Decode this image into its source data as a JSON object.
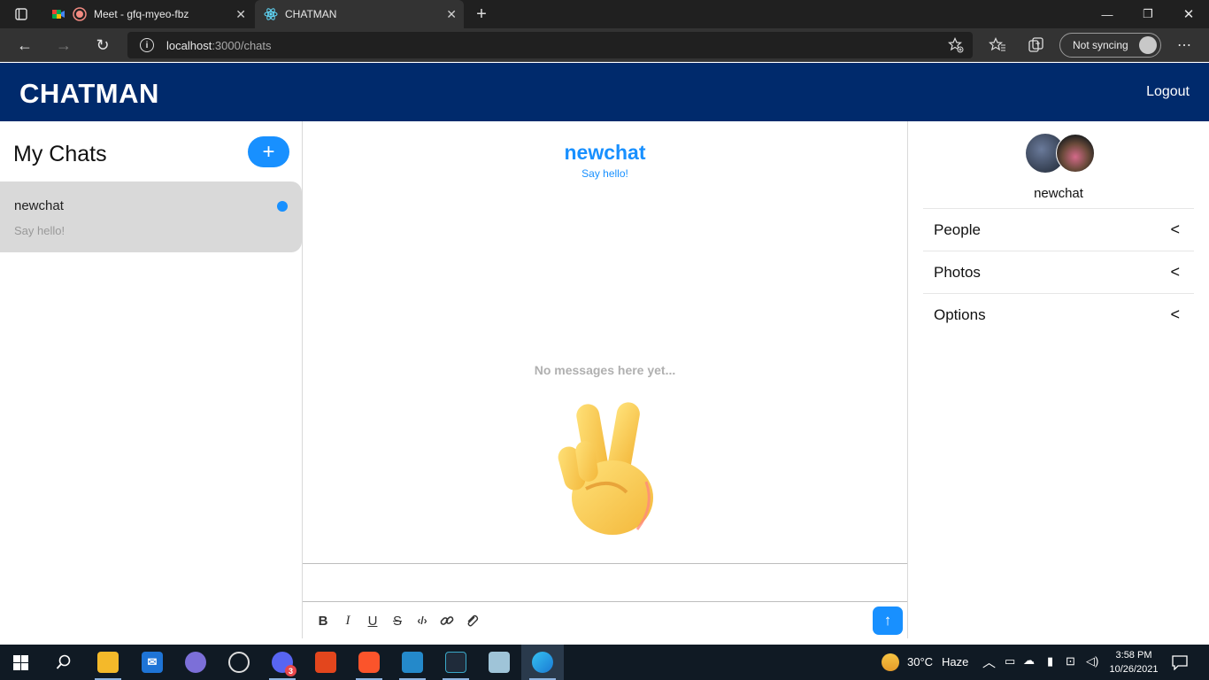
{
  "browser": {
    "tabs": [
      {
        "title": "Meet - gfq-myeo-fbz",
        "active": false
      },
      {
        "title": "CHATMAN",
        "active": true
      }
    ],
    "url_host": "localhost",
    "url_path": ":3000/chats",
    "sync_label": "Not syncing"
  },
  "header": {
    "brand": "CHATMAN",
    "logout_label": "Logout"
  },
  "chat_list": {
    "title": "My Chats",
    "add_label": "+",
    "items": [
      {
        "name": "newchat",
        "preview": "Say hello!",
        "unread": true
      }
    ]
  },
  "chat_feed": {
    "title": "newchat",
    "subtitle": "Say hello!",
    "empty_text": "No messages here yet...",
    "composer_placeholder": "",
    "send_label": "↑"
  },
  "chat_settings": {
    "name": "newchat",
    "sections": [
      {
        "label": "People"
      },
      {
        "label": "Photos"
      },
      {
        "label": "Options"
      }
    ]
  },
  "taskbar": {
    "weather_temp": "30°C",
    "weather_desc": "Haze",
    "time": "3:58 PM",
    "date": "10/26/2021",
    "discord_badge": "3"
  },
  "colors": {
    "header_bg": "#002a6c",
    "accent": "#1890ff",
    "selected_chat_bg": "#d9d9d9"
  }
}
